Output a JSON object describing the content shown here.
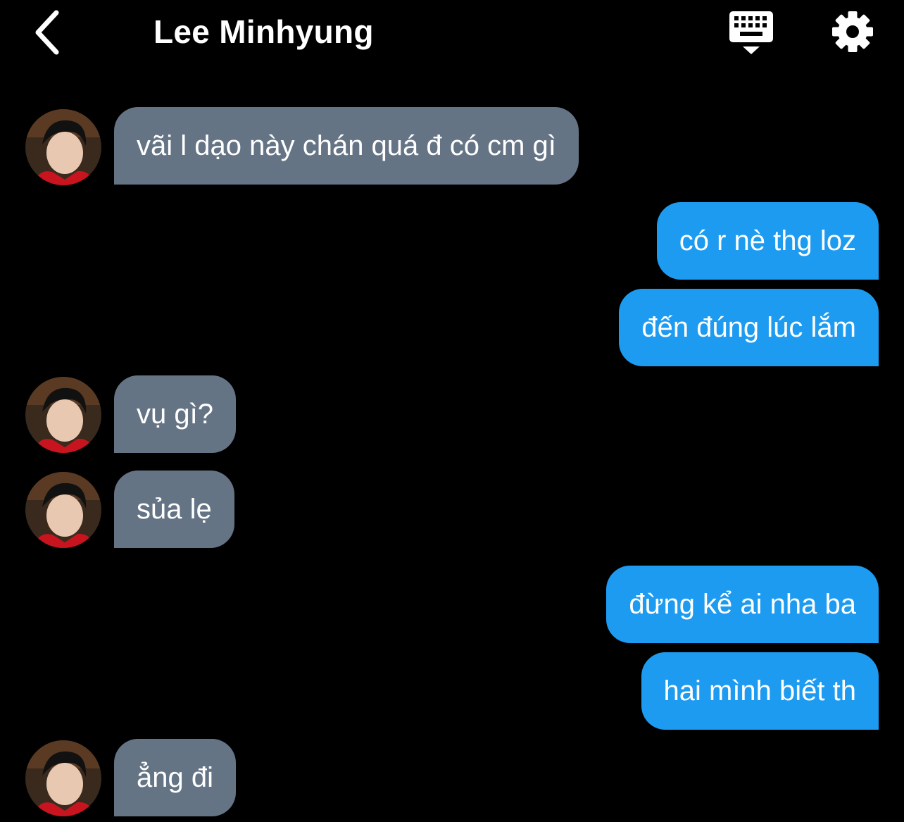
{
  "header": {
    "title": "Lee Minhyung",
    "back_icon": "chevron-left-icon",
    "keyboard_icon": "keyboard-icon",
    "settings_icon": "gear-icon"
  },
  "colors": {
    "background": "#000000",
    "incoming_bubble": "#657485",
    "outgoing_bubble": "#1d9bf0",
    "text": "#ffffff"
  },
  "messages": [
    {
      "direction": "incoming",
      "text": "vãi l dạo này chán quá đ có cm gì"
    },
    {
      "direction": "outgoing",
      "text": "có r nè thg loz"
    },
    {
      "direction": "outgoing",
      "text": "đến đúng lúc lắm"
    },
    {
      "direction": "incoming",
      "text": "vụ gì?"
    },
    {
      "direction": "incoming",
      "text": "sủa lẹ"
    },
    {
      "direction": "outgoing",
      "text": "đừng kể ai nha ba"
    },
    {
      "direction": "outgoing",
      "text": "hai mình biết th"
    },
    {
      "direction": "incoming",
      "text": "ẳng đi"
    }
  ]
}
